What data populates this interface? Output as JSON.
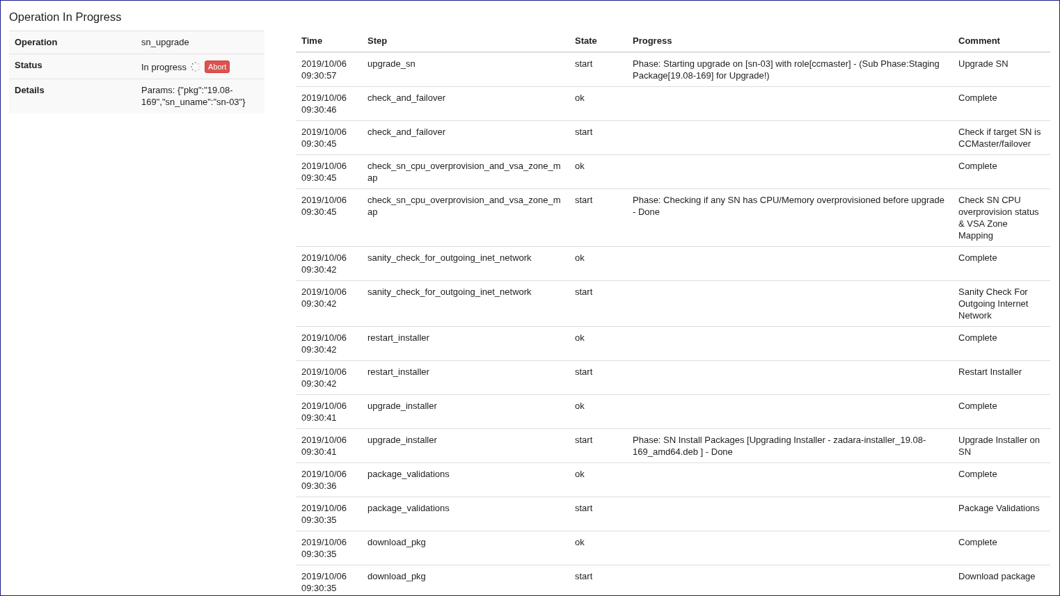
{
  "title": "Operation In Progress",
  "summary": [
    {
      "kind": "text",
      "label": "Operation",
      "value": "sn_upgrade"
    },
    {
      "kind": "status",
      "label": "Status",
      "value": "In progress",
      "action": "Abort"
    },
    {
      "kind": "text",
      "label": "Details",
      "value": "Params: {\"pkg\":\"19.08-169\",\"sn_uname\":\"sn-03\"}"
    }
  ],
  "table": {
    "columns": [
      "Time",
      "Step",
      "State",
      "Progress",
      "Comment"
    ],
    "rows": [
      {
        "time": "2019/10/06 09:30:57",
        "step": "upgrade_sn",
        "state": "start",
        "progress": "Phase: Starting upgrade on [sn-03] with role[ccmaster] - (Sub Phase:Staging Package[19.08-169] for Upgrade!)",
        "comment": "Upgrade SN"
      },
      {
        "time": "2019/10/06 09:30:46",
        "step": "check_and_failover",
        "state": "ok",
        "progress": "",
        "comment": "Complete"
      },
      {
        "time": "2019/10/06 09:30:45",
        "step": "check_and_failover",
        "state": "start",
        "progress": "",
        "comment": "Check if target SN is CCMaster/failover"
      },
      {
        "time": "2019/10/06 09:30:45",
        "step": "check_sn_cpu_overprovision_and_vsa_zone_map",
        "state": "ok",
        "progress": "",
        "comment": "Complete"
      },
      {
        "time": "2019/10/06 09:30:45",
        "step": "check_sn_cpu_overprovision_and_vsa_zone_map",
        "state": "start",
        "progress": "Phase: Checking if any SN has CPU/Memory overprovisioned before upgrade - Done",
        "comment": "Check SN CPU overprovision status & VSA Zone Mapping"
      },
      {
        "time": "2019/10/06 09:30:42",
        "step": "sanity_check_for_outgoing_inet_network",
        "state": "ok",
        "progress": "",
        "comment": "Complete"
      },
      {
        "time": "2019/10/06 09:30:42",
        "step": "sanity_check_for_outgoing_inet_network",
        "state": "start",
        "progress": "",
        "comment": "Sanity Check For Outgoing Internet Network"
      },
      {
        "time": "2019/10/06 09:30:42",
        "step": "restart_installer",
        "state": "ok",
        "progress": "",
        "comment": "Complete"
      },
      {
        "time": "2019/10/06 09:30:42",
        "step": "restart_installer",
        "state": "start",
        "progress": "",
        "comment": "Restart Installer"
      },
      {
        "time": "2019/10/06 09:30:41",
        "step": "upgrade_installer",
        "state": "ok",
        "progress": "",
        "comment": "Complete"
      },
      {
        "time": "2019/10/06 09:30:41",
        "step": "upgrade_installer",
        "state": "start",
        "progress": "Phase: SN Install Packages [Upgrading Installer - zadara-installer_19.08-169_amd64.deb ] - Done",
        "comment": "Upgrade Installer on SN"
      },
      {
        "time": "2019/10/06 09:30:36",
        "step": "package_validations",
        "state": "ok",
        "progress": "",
        "comment": "Complete"
      },
      {
        "time": "2019/10/06 09:30:35",
        "step": "package_validations",
        "state": "start",
        "progress": "",
        "comment": "Package Validations"
      },
      {
        "time": "2019/10/06 09:30:35",
        "step": "download_pkg",
        "state": "ok",
        "progress": "",
        "comment": "Complete"
      },
      {
        "time": "2019/10/06 09:30:35",
        "step": "download_pkg",
        "state": "start",
        "progress": "",
        "comment": "Download package"
      }
    ]
  }
}
